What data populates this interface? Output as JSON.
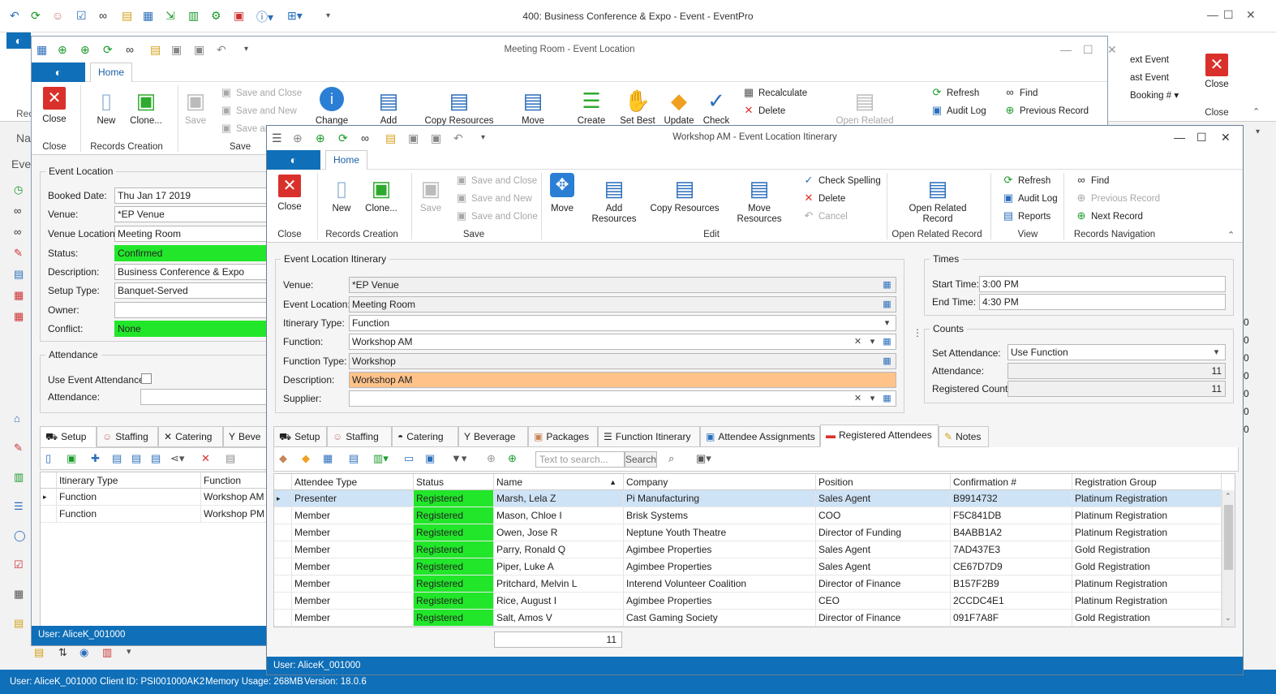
{
  "main": {
    "title": "400: Business Conference & Expo - Event - EventPro",
    "qat_icons": [
      "back-icon",
      "refresh-icon",
      "user-icon",
      "clipboard-icon",
      "binoculars-icon",
      "note-icon",
      "grid-icon",
      "export-icon",
      "chart-icon",
      "gear-icon",
      "calendar-icon",
      "info-icon",
      "tree-icon",
      "dropdown-icon"
    ],
    "ribbon_right": {
      "next_event": "ext Event",
      "last_event": "ast Event",
      "booking": "Booking #",
      "close": "Close",
      "close_group": "Close",
      "rec": "Rec",
      "nav": "Nav",
      "eve": "Eve"
    },
    "side_values": [
      "0",
      "0",
      "0",
      "0",
      "0",
      "0",
      "0"
    ],
    "status": {
      "user": "User: AliceK_001000",
      "client": "Client ID: PSI001000AK2",
      "memory": "Memory Usage: 268MB",
      "version": "Version: 18.0.6"
    }
  },
  "mid": {
    "title": "Meeting Room - Event Location",
    "home_tab": "Home",
    "ribbon": {
      "close": "Close",
      "new": "New",
      "clone": "Clone...",
      "save": "Save",
      "save_and_close": "Save and Close",
      "save_and_new": "Save and New",
      "save_and": "Save an",
      "change": "Change",
      "add_resources": "Add Resources",
      "copy_resources": "Copy Resources",
      "move_resources": "Move Resources",
      "create": "Create",
      "set_best": "Set Best",
      "update": "Update",
      "check": "Check",
      "recalculate": "Recalculate",
      "delete": "Delete",
      "open_related": "Open Related",
      "refresh": "Refresh",
      "audit_log": "Audit Log",
      "find": "Find",
      "previous_record": "Previous Record",
      "group_close": "Close",
      "group_records_creation": "Records Creation",
      "group_save": "Save"
    },
    "event_location": {
      "legend": "Event Location",
      "booked_date_label": "Booked Date:",
      "booked_date": "Thu Jan 17 2019",
      "venue_label": "Venue:",
      "venue": "*EP Venue",
      "venue_location_label": "Venue Location:",
      "venue_location": "Meeting Room",
      "status_label": "Status:",
      "status": "Confirmed",
      "description_label": "Description:",
      "description": "Business Conference & Expo",
      "setup_type_label": "Setup Type:",
      "setup_type": "Banquet-Served",
      "owner_label": "Owner:",
      "owner": "",
      "conflict_label": "Conflict:",
      "conflict": "None"
    },
    "attendance": {
      "legend": "Attendance",
      "use_event_label": "Use Event Attendance",
      "attendance_label": "Attendance:"
    },
    "tabs": [
      "Setup",
      "Staffing",
      "Catering",
      "Beve"
    ],
    "grid": {
      "headers": [
        "Itinerary Type",
        "Function"
      ],
      "rows": [
        [
          "Function",
          "Workshop AM"
        ],
        [
          "Function",
          "Workshop PM"
        ]
      ]
    },
    "status": "User: AliceK_001000"
  },
  "front": {
    "title": "Workshop AM - Event Location Itinerary",
    "home_tab": "Home",
    "ribbon": {
      "close": "Close",
      "new": "New",
      "clone": "Clone...",
      "save": "Save",
      "save_and_close": "Save and Close",
      "save_and_new": "Save and New",
      "save_and_clone": "Save and Clone",
      "move": "Move",
      "add_resources": "Add Resources",
      "copy_resources": "Copy Resources",
      "move_resources": "Move Resources",
      "check_spelling": "Check Spelling",
      "delete": "Delete",
      "cancel": "Cancel",
      "open_related_1": "Open Related",
      "open_related_2": "Record",
      "refresh": "Refresh",
      "audit_log": "Audit Log",
      "reports": "Reports",
      "find": "Find",
      "previous_record": "Previous Record",
      "next_record": "Next Record",
      "group_close": "Close",
      "group_records_creation": "Records Creation",
      "group_save": "Save",
      "group_edit": "Edit",
      "group_open_related": "Open Related Record",
      "group_view": "View",
      "group_nav": "Records Navigation"
    },
    "itinerary": {
      "legend": "Event Location Itinerary",
      "venue_label": "Venue:",
      "venue": "*EP Venue",
      "event_location_label": "Event Location:",
      "event_location": "Meeting Room",
      "itinerary_type_label": "Itinerary Type:",
      "itinerary_type": "Function",
      "function_label": "Function:",
      "function": "Workshop AM",
      "function_type_label": "Function Type:",
      "function_type": "Workshop",
      "description_label": "Description:",
      "description": "Workshop AM",
      "supplier_label": "Supplier:",
      "supplier": ""
    },
    "times": {
      "legend": "Times",
      "start_label": "Start Time:",
      "start": "3:00 PM",
      "end_label": "End Time:",
      "end": "4:30 PM"
    },
    "counts": {
      "legend": "Counts",
      "set_attendance_label": "Set Attendance:",
      "set_attendance": "Use Function",
      "attendance_label": "Attendance:",
      "attendance": "11",
      "registered_count_label": "Registered Count:",
      "registered_count": "11"
    },
    "tabs": [
      "Setup",
      "Staffing",
      "Catering",
      "Beverage",
      "Packages",
      "Function Itinerary",
      "Attendee Assignments",
      "Registered Attendees",
      "Notes"
    ],
    "search_placeholder": "Text to search...",
    "search_button": "Search",
    "grid": {
      "headers": [
        "Attendee Type",
        "Status",
        "Name",
        "Company",
        "Position",
        "Confirmation #",
        "Registration Group"
      ],
      "rows": [
        [
          "Presenter",
          "Registered",
          "Marsh, Lela Z",
          "Pi Manufacturing",
          "Sales Agent",
          "B9914732",
          "Platinum Registration"
        ],
        [
          "Member",
          "Registered",
          "Mason, Chloe I",
          "Brisk Systems",
          "COO",
          "F5C841DB",
          "Platinum Registration"
        ],
        [
          "Member",
          "Registered",
          "Owen, Jose R",
          "Neptune Youth Theatre",
          "Director of Funding",
          "B4ABB1A2",
          "Platinum Registration"
        ],
        [
          "Member",
          "Registered",
          "Parry, Ronald Q",
          "Agimbee Properties",
          "Sales Agent",
          "7AD437E3",
          "Gold Registration"
        ],
        [
          "Member",
          "Registered",
          "Piper, Luke A",
          "Agimbee Properties",
          "Sales Agent",
          "CE67D7D9",
          "Gold Registration"
        ],
        [
          "Member",
          "Registered",
          "Pritchard, Melvin L",
          "Interend Volunteer Coalition",
          "Director of Finance",
          "B157F2B9",
          "Platinum Registration"
        ],
        [
          "Member",
          "Registered",
          "Rice, August I",
          "Agimbee Properties",
          "CEO",
          "2CCDC4E1",
          "Platinum Registration"
        ],
        [
          "Member",
          "Registered",
          "Salt, Amos V",
          "Cast Gaming Society",
          "Director of Finance",
          "091F7A8F",
          "Gold Registration"
        ]
      ],
      "footer_count": "11"
    },
    "status": "User: AliceK_001000"
  },
  "colors": {
    "accent": "#0f6fb8",
    "registered": "#22e62a",
    "description_highlight": "#ffc38a"
  }
}
